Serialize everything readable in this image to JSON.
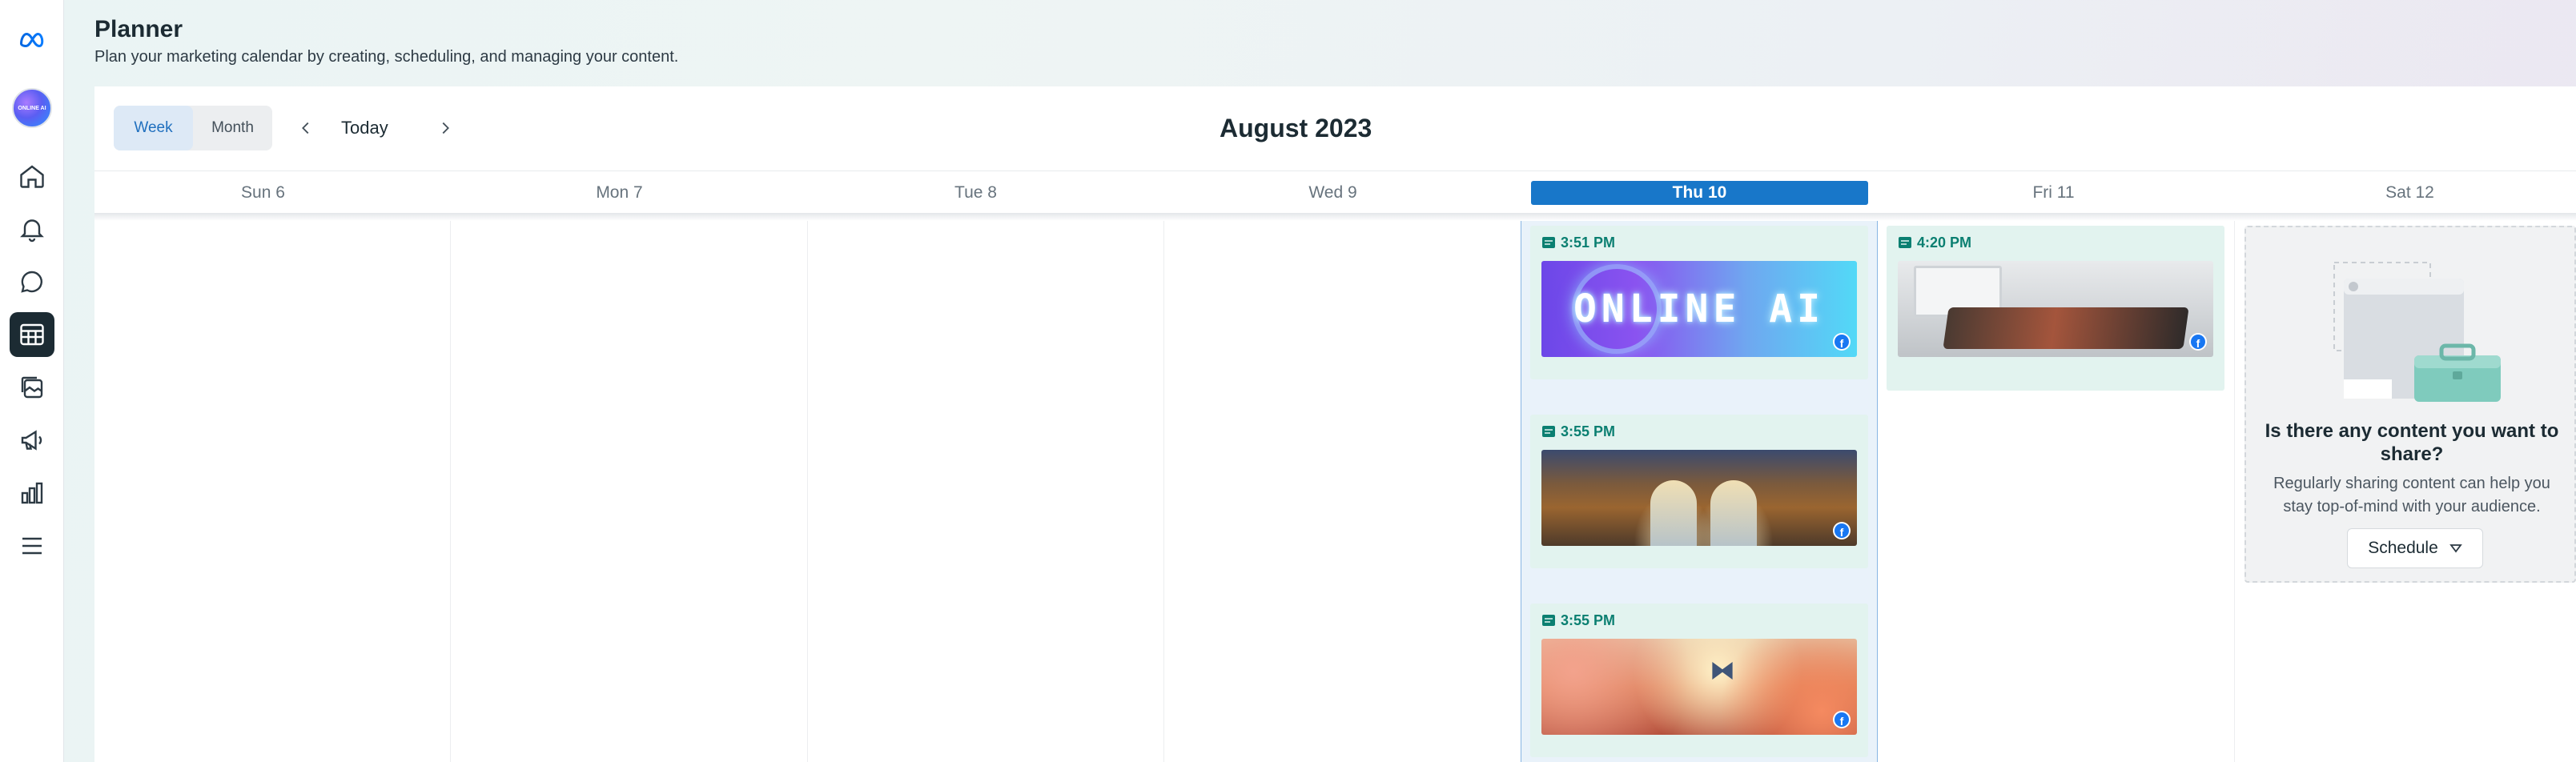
{
  "header": {
    "title": "Planner",
    "subtitle": "Plan your marketing calendar by creating, scheduling, and managing your content."
  },
  "sidebar": {
    "account_avatar_text": "ONLINE AI",
    "items": [
      {
        "name": "home",
        "icon": "home-icon"
      },
      {
        "name": "notifications",
        "icon": "bell-icon"
      },
      {
        "name": "inbox",
        "icon": "chat-bubble-icon"
      },
      {
        "name": "planner",
        "icon": "calendar-grid-icon",
        "active": true
      },
      {
        "name": "content",
        "icon": "content-stack-icon"
      },
      {
        "name": "ads",
        "icon": "megaphone-icon"
      },
      {
        "name": "insights",
        "icon": "bar-chart-icon"
      },
      {
        "name": "all-tools",
        "icon": "menu-icon"
      }
    ]
  },
  "toolbar": {
    "views": [
      "Week",
      "Month"
    ],
    "active_view": "Week",
    "today_label": "Today",
    "month_label": "August 2023"
  },
  "days": [
    {
      "label": "Sun 6",
      "today": false
    },
    {
      "label": "Mon 7",
      "today": false
    },
    {
      "label": "Tue 8",
      "today": false
    },
    {
      "label": "Wed 9",
      "today": false
    },
    {
      "label": "Thu 10",
      "today": true
    },
    {
      "label": "Fri 11",
      "today": false
    },
    {
      "label": "Sat 12",
      "today": false
    }
  ],
  "posts": [
    {
      "day": "Thu 10",
      "time": "3:51 PM",
      "thumbnail_text": "ONLINE AI",
      "platform": "facebook"
    },
    {
      "day": "Thu 10",
      "time": "3:55 PM",
      "platform": "facebook"
    },
    {
      "day": "Thu 10",
      "time": "3:55 PM",
      "platform": "facebook"
    },
    {
      "day": "Fri 11",
      "time": "4:20 PM",
      "platform": "facebook"
    }
  ],
  "empty_state": {
    "title": "Is there any content you want to share?",
    "text": "Regularly sharing content can help you stay top-of-mind with your audience.",
    "button_label": "Schedule"
  },
  "colors": {
    "accent": "#1877c9",
    "post_card_bg": "#e2f3ef",
    "post_time": "#0b7f71",
    "facebook": "#1877f2"
  }
}
